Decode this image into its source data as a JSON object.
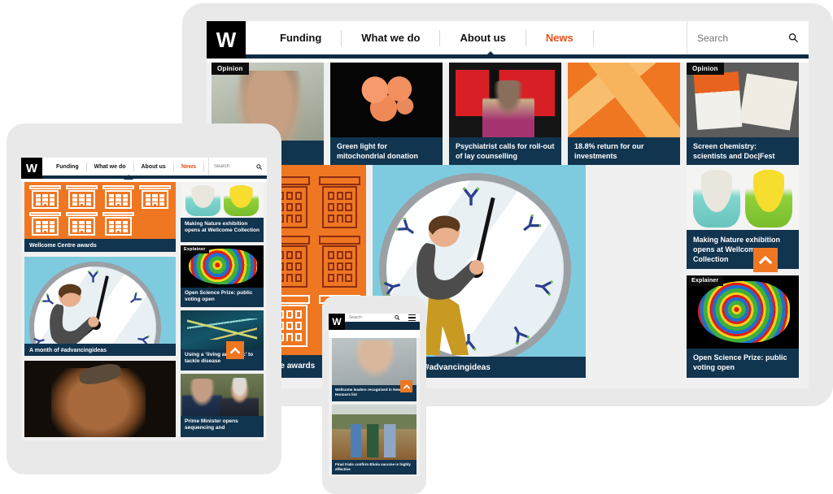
{
  "brand": {
    "logo_letter": "W",
    "accent_orange": "#ef7722",
    "navy": "#0e2b43",
    "caption_navy": "#11344f"
  },
  "nav": {
    "items": [
      {
        "label": "Funding",
        "active": false
      },
      {
        "label": "What we do",
        "active": false
      },
      {
        "label": "About us",
        "active": false
      },
      {
        "label": "News",
        "active": true
      }
    ],
    "search_placeholder": "Search",
    "search_value": "",
    "search_icon": "magnifier-icon",
    "menu_icon": "hamburger-icon"
  },
  "desktop": {
    "top_row": [
      {
        "badge": "Opinion",
        "caption": "",
        "photo": "man-portrait"
      },
      {
        "badge": "",
        "caption": "Green light for mitochondrial donation",
        "photo": "cell-micrograph"
      },
      {
        "badge": "",
        "caption": "Psychiatrist calls for roll-out of lay counselling",
        "photo": "ted-talk-speaker"
      },
      {
        "badge": "",
        "caption": "18.8% return for our investments",
        "photo": "orange-abstract"
      },
      {
        "badge": "Opinion",
        "caption": "Screen chemistry: scientists and Doc|Fest",
        "photo": "docfest-leaflets"
      }
    ],
    "feature_left": {
      "caption": "Wellcome Centre awards",
      "photo": "building-grid"
    },
    "feature_main": {
      "caption": "A month of #advancingideas",
      "photo": "clock-illustration"
    },
    "side_cards": [
      {
        "badge": "",
        "caption": "Making Nature exhibition opens at Wellcome Collection",
        "photo": "budgerigars"
      },
      {
        "badge": "Explainer",
        "caption": "Open Science Prize: public voting open",
        "photo": "brain-scan"
      }
    ],
    "to_top_label": "Back to top"
  },
  "tablet": {
    "feature": {
      "caption": "Wellcome Centre awards",
      "photo": "building-grid"
    },
    "main_cards": [
      {
        "caption": "A month of #advancingideas",
        "photo": "clock-illustration"
      },
      {
        "caption": "",
        "photo": "hair-closeup"
      }
    ],
    "side_cards": [
      {
        "badge": "",
        "caption": "Making Nature exhibition opens at Wellcome Collection",
        "photo": "budgerigars"
      },
      {
        "badge": "Explainer",
        "caption": "Open Science Prize: public voting open",
        "photo": "brain-scan"
      },
      {
        "badge": "",
        "caption": "Using a ‘living antibiotic’ to tackle disease",
        "photo": "zebrafish"
      },
      {
        "badge": "",
        "caption": "Prime Minister opens sequencing and",
        "photo": "prime-minister"
      }
    ],
    "to_top_label": "Back to top"
  },
  "phone": {
    "cards": [
      {
        "caption": "Wellcome leaders recognised in New Year’s Honours list",
        "photo": "older-man-portrait"
      },
      {
        "caption": "Final trials confirm Ebola vaccine is highly effective",
        "photo": "ebola-field-workers"
      }
    ],
    "to_top_label": "Back to top"
  }
}
